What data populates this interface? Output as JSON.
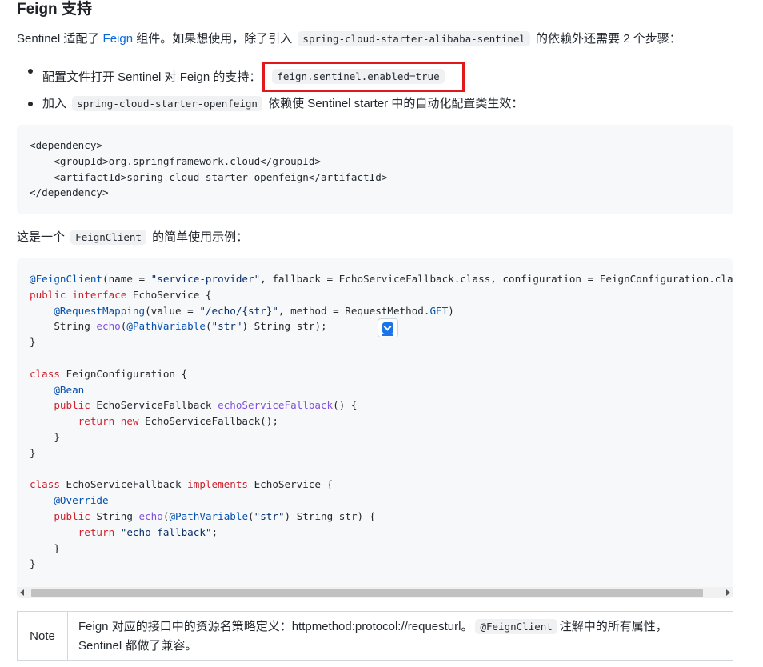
{
  "heading": "Feign 支持",
  "intro": {
    "before": "Sentinel 适配了 ",
    "link": "Feign",
    "middle": " 组件。如果想使用，除了引入 ",
    "code": "spring-cloud-starter-alibaba-sentinel",
    "after": " 的依赖外还需要 2 个步骤："
  },
  "bullets": [
    {
      "text": "配置文件打开 Sentinel 对 Feign 的支持：",
      "code": "feign.sentinel.enabled=true"
    },
    {
      "before": "加入 ",
      "code": "spring-cloud-starter-openfeign",
      "after": " 依赖使 Sentinel starter 中的自动化配置类生效："
    }
  ],
  "dependency_code": {
    "open": "<dependency>",
    "groupId_open": "<groupId>",
    "groupId": "org.springframework.cloud",
    "groupId_close": "</groupId>",
    "artifactId_open": "<artifactId>",
    "artifactId": "spring-cloud-starter-openfeign",
    "artifactId_close": "</artifactId>",
    "close": "</dependency>"
  },
  "usage_intro": {
    "before": "这是一个 ",
    "code": "FeignClient",
    "after": " 的简单使用示例："
  },
  "java_code": {
    "l1_ann": "@FeignClient",
    "l1_rest1": "(name = ",
    "l1_str": "\"service-provider\"",
    "l1_rest2": ", fallback = EchoServiceFallback.class, configuration = FeignConfiguration.class)",
    "l2_kw1": "public",
    "l2_kw2": "interface",
    "l2_rest": " EchoService {",
    "l3_ann": "@RequestMapping",
    "l3_rest1": "(value = ",
    "l3_str": "\"/echo/{str}\"",
    "l3_rest2": ", method = RequestMethod.",
    "l3_get": "GET",
    "l3_end": ")",
    "l4_a": "String ",
    "l4_fn": "echo",
    "l4_b": "(",
    "l4_ann": "@PathVariable",
    "l4_c": "(",
    "l4_str": "\"str\"",
    "l4_d": ") String str);",
    "brace_close": "}",
    "l7_kw": "class",
    "l7_rest": " FeignConfiguration {",
    "l8_ann": "@Bean",
    "l9_kw": "public",
    "l9_a": " EchoServiceFallback ",
    "l9_fn": "echoServiceFallback",
    "l9_b": "() {",
    "l10_kw1": "return",
    "l10_kw2": "new",
    "l10_rest": " EchoServiceFallback();",
    "l15_kw1": "class",
    "l15_a": " EchoServiceFallback ",
    "l15_kw2": "implements",
    "l15_b": " EchoService {",
    "l16_ann": "@Override",
    "l17_kw": "public",
    "l17_a": " String ",
    "l17_fn": "echo",
    "l17_b": "(",
    "l17_ann": "@PathVariable",
    "l17_c": "(",
    "l17_str": "\"str\"",
    "l17_d": ") String str) {",
    "l18_kw": "return",
    "l18_str": "\"echo fallback\"",
    "l18_end": ";"
  },
  "note": {
    "label": "Note",
    "line1_before": "Feign 对应的接口中的资源名策略定义：httpmethod:protocol://requesturl。",
    "line1_code": "@FeignClient",
    "line1_after": "注解中的所有属性，",
    "line2": "Sentinel 都做了兼容。"
  },
  "colors": {
    "highlight": "#e2191b",
    "link": "#0969da",
    "code_bg": "#f6f8fa"
  }
}
